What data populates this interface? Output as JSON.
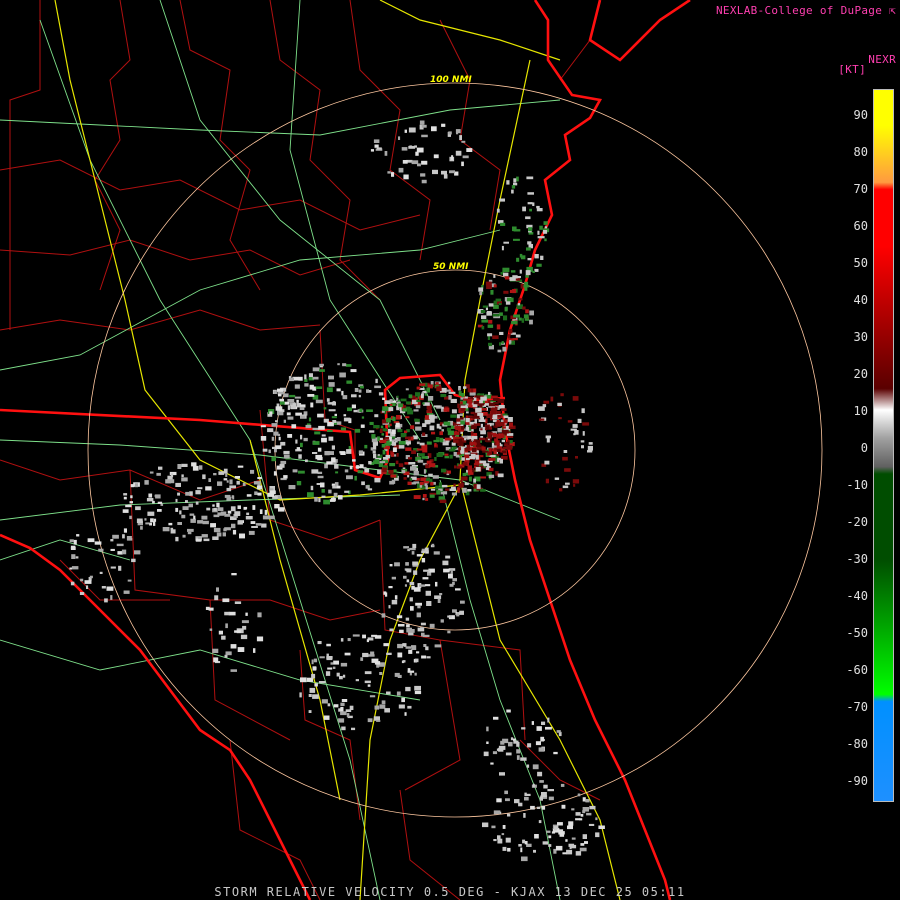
{
  "header": {
    "credit": "NEXLAB-College of DuPage ⇱",
    "product_code": "NEXR",
    "units": "[KT]"
  },
  "range_rings": [
    {
      "label": "50 NMI"
    },
    {
      "label": "100 NMI"
    }
  ],
  "colorbar": {
    "ticks": [
      "90",
      "80",
      "70",
      "60",
      "50",
      "40",
      "30",
      "20",
      "10",
      "0",
      "-10",
      "-20",
      "-30",
      "-40",
      "-50",
      "-60",
      "-70",
      "-80",
      "-90"
    ],
    "colors": {
      "positive_high": "#ffff00",
      "positive_orange": "#ff9a40",
      "positive_red": "#ff0000",
      "positive_dark": "#5a0000",
      "near_zero": "#a0a0a0",
      "negative_dark": "#004d00",
      "negative_green": "#00ff00",
      "negative_blue": "#0090ff"
    }
  },
  "footer": "STORM RELATIVE VELOCITY 0.5 DEG - KJAX 13 DEC 25 05:11"
}
